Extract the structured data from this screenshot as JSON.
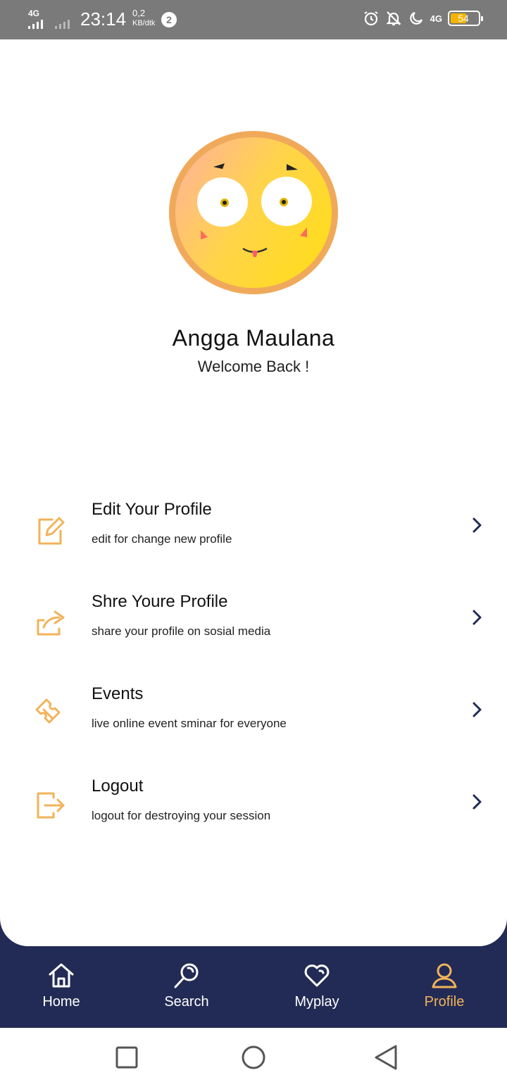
{
  "status_bar": {
    "network": "4G",
    "time": "23:14",
    "speed_value": "0,2",
    "speed_unit": "KB/dtk",
    "notification_count": "2",
    "network_right": "4G",
    "battery": "54"
  },
  "profile": {
    "name": "Angga Maulana",
    "greeting": "Welcome Back !"
  },
  "menu": [
    {
      "title": "Edit Your Profile",
      "subtitle": "edit for change new profile",
      "icon": "edit-icon"
    },
    {
      "title": "Shre Youre Profile",
      "subtitle": "share your profile on sosial media",
      "icon": "share-icon"
    },
    {
      "title": "Events",
      "subtitle": "live online  event sminar for everyone",
      "icon": "ticket-icon"
    },
    {
      "title": "Logout",
      "subtitle": "logout for destroying your session",
      "icon": "logout-icon"
    }
  ],
  "bottom_nav": [
    {
      "label": "Home",
      "icon": "home-icon",
      "active": false
    },
    {
      "label": "Search",
      "icon": "search-icon",
      "active": false
    },
    {
      "label": "Myplay",
      "icon": "heart-icon",
      "active": false
    },
    {
      "label": "Profile",
      "icon": "user-icon",
      "active": true
    }
  ],
  "colors": {
    "accent": "#F2B35A",
    "nav_background": "#222B55",
    "status_bar": "#7A7A7A",
    "chevron": "#222B55"
  }
}
